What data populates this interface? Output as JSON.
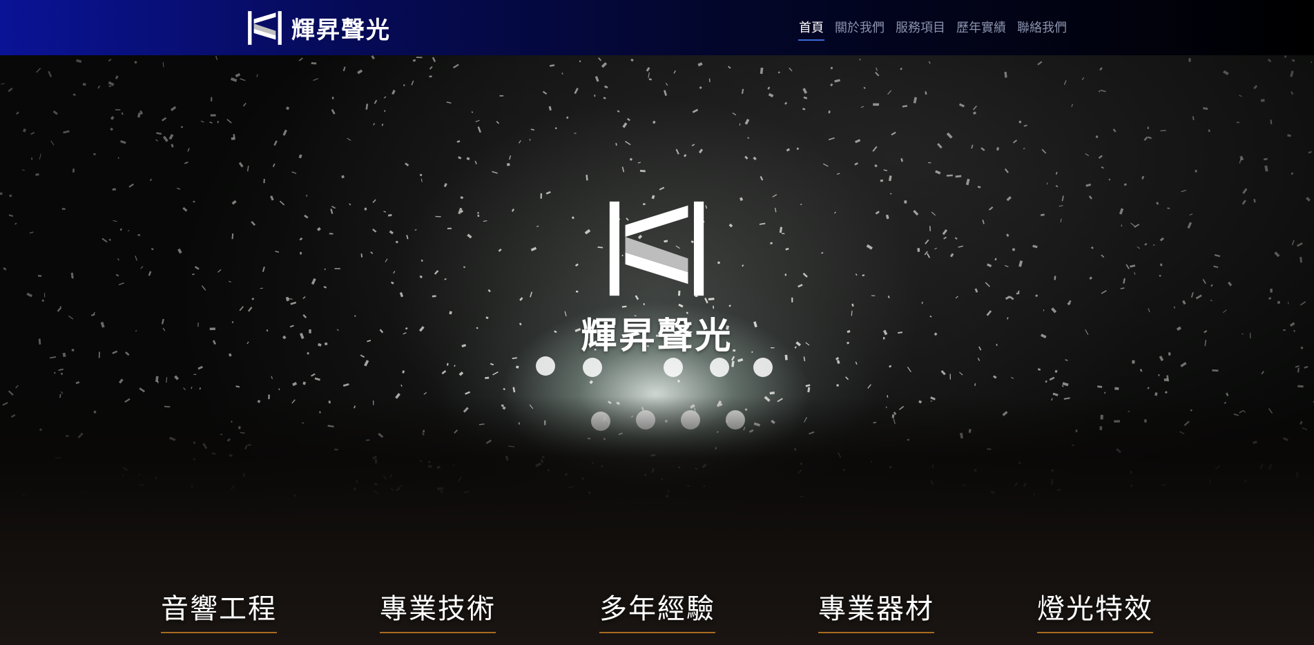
{
  "brand": {
    "name": "輝昇聲光",
    "logo": "hs-logo-icon"
  },
  "nav": {
    "items": [
      {
        "label": "首頁",
        "active": true
      },
      {
        "label": "關於我們",
        "active": false
      },
      {
        "label": "服務項目",
        "active": false
      },
      {
        "label": "歷年實績",
        "active": false
      },
      {
        "label": "聯絡我們",
        "active": false
      }
    ]
  },
  "hero": {
    "title": "輝昇聲光",
    "features": [
      "音響工程",
      "專業技術",
      "多年經驗",
      "專業器材",
      "燈光特效"
    ]
  },
  "colors": {
    "nav_gradient_start": "#0a1396",
    "nav_inactive_text": "#8b93ad",
    "nav_active_underline": "#3a6bd8",
    "feature_underline": "#a86b1e"
  }
}
